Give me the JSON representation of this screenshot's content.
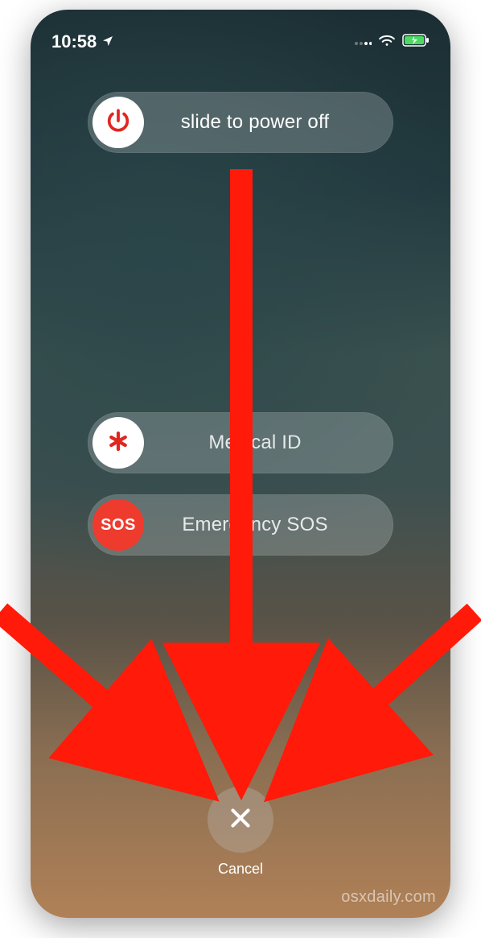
{
  "status_bar": {
    "time": "10:58",
    "location_icon": "location-arrow",
    "signal_icon": "cell-signal",
    "wifi_icon": "wifi",
    "battery_icon": "battery-charging",
    "battery_color": "#4cd964"
  },
  "sliders": {
    "power_off": {
      "label": "slide to power off",
      "icon": "power-icon",
      "icon_color": "#e0261e",
      "knob_bg": "#ffffff"
    },
    "medical_id": {
      "label": "Medical ID",
      "icon": "asterisk-icon",
      "icon_color": "#e0261e",
      "knob_bg": "#ffffff"
    },
    "emergency_sos": {
      "label": "Emergency SOS",
      "icon_text": "SOS",
      "knob_bg": "#ef3b2e"
    }
  },
  "cancel": {
    "label": "Cancel",
    "icon": "close-icon"
  },
  "watermark": "osxdaily.com",
  "annotation": {
    "arrow_color": "#ff1a0a",
    "arrows_point_to": "cancel-button"
  }
}
